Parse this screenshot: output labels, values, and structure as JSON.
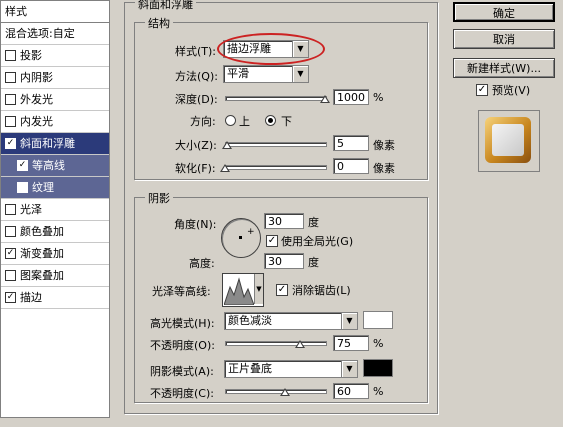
{
  "sidebar": {
    "header": "样式",
    "items": [
      {
        "label": "混合选项:自定",
        "checkbox": false,
        "checked": false
      },
      {
        "label": "投影",
        "checkbox": true,
        "checked": false
      },
      {
        "label": "内阴影",
        "checkbox": true,
        "checked": false
      },
      {
        "label": "外发光",
        "checkbox": true,
        "checked": false
      },
      {
        "label": "内发光",
        "checkbox": true,
        "checked": false
      },
      {
        "label": "斜面和浮雕",
        "checkbox": true,
        "checked": true,
        "selected": true
      },
      {
        "label": "等高线",
        "checkbox": true,
        "checked": true,
        "sub": true
      },
      {
        "label": "纹理",
        "checkbox": true,
        "checked": false,
        "sub": true
      },
      {
        "label": "光泽",
        "checkbox": true,
        "checked": false
      },
      {
        "label": "颜色叠加",
        "checkbox": true,
        "checked": false
      },
      {
        "label": "渐变叠加",
        "checkbox": true,
        "checked": true
      },
      {
        "label": "图案叠加",
        "checkbox": true,
        "checked": false
      },
      {
        "label": "描边",
        "checkbox": true,
        "checked": true
      }
    ],
    "check_mark": "✓"
  },
  "buttons": {
    "ok": "确定",
    "cancel": "取消",
    "new_style": "新建样式(W)...",
    "preview": "预览(V)",
    "preview_checked": true
  },
  "bevel": {
    "section_title": "斜面和浮雕",
    "structure_title": "结构",
    "style_label": "样式(T):",
    "style_value": "描边浮雕",
    "technique_label": "方法(Q):",
    "technique_value": "平滑",
    "depth_label": "深度(D):",
    "depth_value": "1000",
    "depth_unit": "%",
    "depth_level": 1.0,
    "direction_label": "方向:",
    "direction_up": "上",
    "direction_down": "下",
    "direction_selected": "下",
    "size_label": "大小(Z):",
    "size_value": "5",
    "size_unit": "像素",
    "size_level": 0.02,
    "soften_label": "软化(F):",
    "soften_value": "0",
    "soften_unit": "像素",
    "soften_level": 0.0
  },
  "shading": {
    "title": "阴影",
    "angle_label": "角度(N):",
    "angle_value": "30",
    "angle_unit": "度",
    "global_light_label": "使用全局光(G)",
    "global_light_checked": true,
    "altitude_label": "高度:",
    "altitude_value": "30",
    "altitude_unit": "度",
    "gloss_label": "光泽等高线:",
    "antialias_label": "消除锯齿(L)",
    "antialias_checked": true,
    "highlight_label": "高光模式(H):",
    "highlight_value": "颜色减淡",
    "highlight_color": "#ffffff",
    "highlight_opacity_label": "不透明度(O):",
    "highlight_opacity_value": "75",
    "highlight_opacity_unit": "%",
    "highlight_opacity_level": 0.75,
    "shadow_label": "阴影模式(A):",
    "shadow_value": "正片叠底",
    "shadow_color": "#000000",
    "shadow_opacity_label": "不透明度(C):",
    "shadow_opacity_value": "60",
    "shadow_opacity_unit": "%",
    "shadow_opacity_level": 0.6
  },
  "colors": {
    "selected_bg": "#2b3a7a",
    "sub_bg": "#5d6694",
    "highlight_circle": "#cc2222",
    "preview_gold": "#d09a30"
  }
}
